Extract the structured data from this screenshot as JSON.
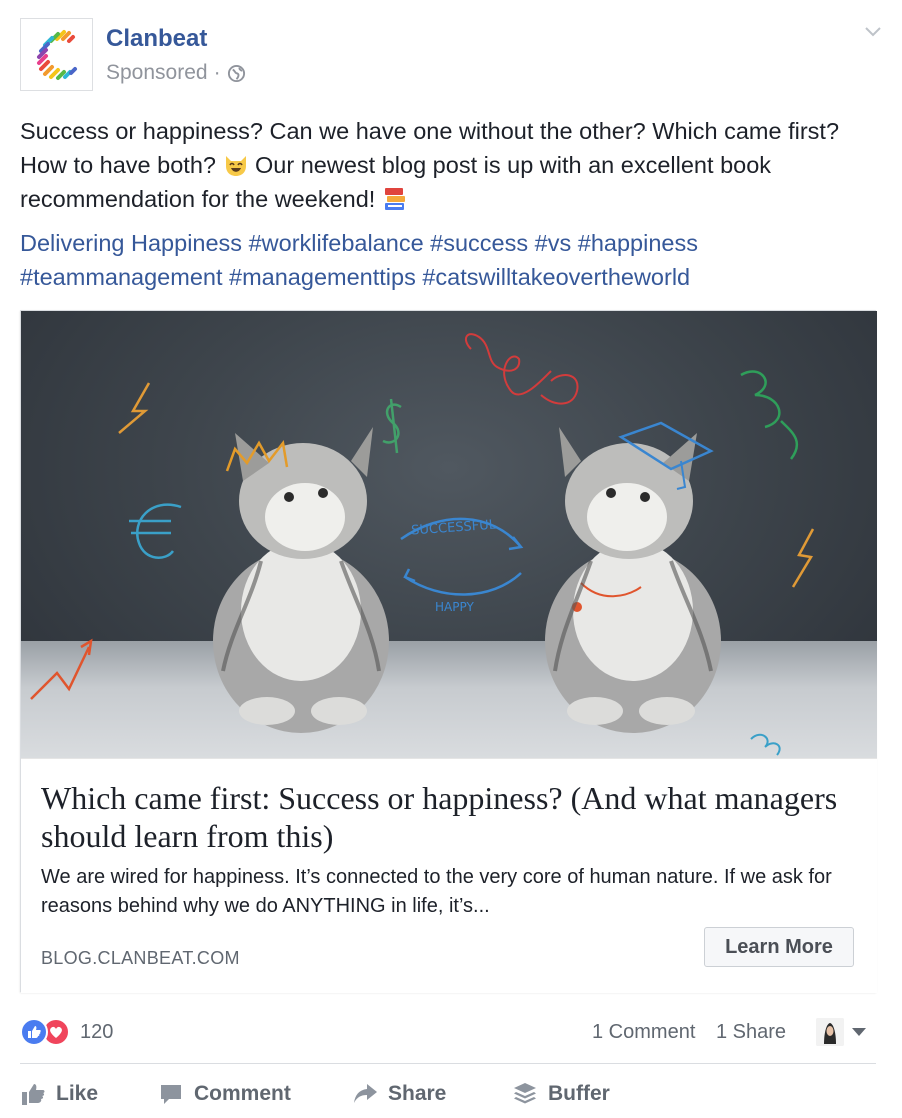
{
  "post": {
    "page_name": "Clanbeat",
    "sponsored_label": "Sponsored",
    "meta_separator": "·",
    "text_part1": "Success or happiness? Can we have one without the other? Which came first? How to have both?",
    "text_part2": "Our newest blog post is up with an excellent book recommendation for the weekend!",
    "link_text": "Delivering Happiness",
    "hashtags": [
      "#worklifebalance",
      "#success",
      "#vs",
      "#happiness",
      "#teammanagement",
      "#managementtips",
      "#catswilltakeovertheworld"
    ]
  },
  "icons": {
    "logo": "clanbeat-logo",
    "privacy": "globe-icon",
    "menu": "chevron-down-icon",
    "emoji1": "smiling-cat-emoji",
    "emoji2": "books-emoji"
  },
  "card": {
    "image_text_top": "SUCCESSFUL",
    "image_text_bottom": "HAPPY",
    "title": "Which came first: Success or happiness? (And what managers should learn from this)",
    "description": "We are wired for happiness. It’s connected to the very core of human nature. If we ask for reasons behind why we do ANYTHING in life, it’s...",
    "domain": "BLOG.CLANBEAT.COM",
    "cta_label": "Learn More"
  },
  "stats": {
    "reaction_count": "120",
    "comments": "1 Comment",
    "shares": "1 Share"
  },
  "actions": {
    "like": "Like",
    "comment": "Comment",
    "share": "Share",
    "buffer": "Buffer"
  },
  "colors": {
    "link_blue": "#365899",
    "meta_gray": "#90949c",
    "like_blue": "#4a7cf0",
    "love_red": "#f0455c"
  }
}
